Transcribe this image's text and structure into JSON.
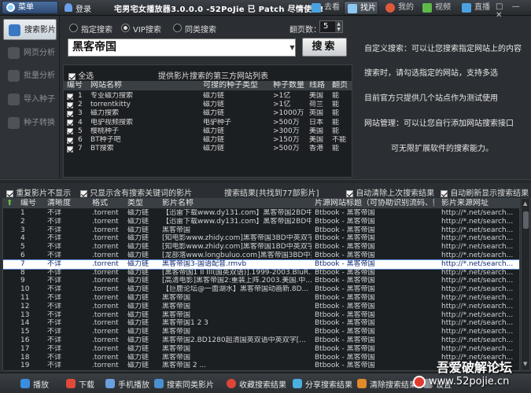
{
  "titlebar": {
    "menu_label": "菜单",
    "login_label": "登录",
    "title": "宅男宅女播放器3.0.0.0 -52PoJie 已 Patch 尽情使用!",
    "tabs": [
      "去看",
      "找片",
      "我的",
      "视频",
      "直播"
    ],
    "active_tab": "找片",
    "window_controls": "□ — ✕"
  },
  "sidebar": {
    "items": [
      {
        "label": "搜索影片",
        "active": true,
        "icon": "search-icon"
      },
      {
        "label": "网页分析",
        "active": false,
        "icon": "globe-icon"
      },
      {
        "label": "批量分析",
        "active": false,
        "icon": "batch-icon"
      },
      {
        "label": "导入种子",
        "active": false,
        "icon": "import-icon"
      },
      {
        "label": "种子转换",
        "active": false,
        "icon": "convert-icon"
      }
    ]
  },
  "search": {
    "modes": [
      "指定搜索",
      "VIP搜索",
      "同类搜索"
    ],
    "selected_mode": "VIP搜索",
    "pages_label": "翻页数：",
    "pages_value": "5",
    "keyword": "黑客帝国",
    "search_button": "搜索"
  },
  "site_list": {
    "select_all_label": "全选",
    "title": "提供影片搜索的第三方网站列表",
    "columns": [
      "编号",
      "网站名称",
      "可搜的种子类型",
      "种子数量",
      "线路",
      "翻页"
    ],
    "rows": [
      [
        "1",
        "专业磁力搜索",
        "磁力链",
        ">1亿",
        "美国",
        "能"
      ],
      [
        "2",
        "torrentkitty",
        "磁力链",
        ">1亿",
        "荷兰",
        "能"
      ],
      [
        "3",
        "磁力搜索",
        "磁力链",
        ">1000万",
        "英国",
        "能"
      ],
      [
        "4",
        "电驴视频搜索",
        "电驴种子",
        ">500万",
        "日本",
        "能"
      ],
      [
        "5",
        "樱桃种子",
        "磁力链",
        ">300万",
        "美国",
        "能"
      ],
      [
        "6",
        "BT种子吧",
        "磁力链",
        ">150万",
        "美国",
        "不能"
      ],
      [
        "7",
        "BT搜索",
        "磁力链",
        ">500万",
        "香港",
        "能"
      ]
    ]
  },
  "info": {
    "lines": [
      "自定义搜索：可以让您搜索指定网站上的内容",
      "搜索时，请勾选指定的网站，支持多选",
      "目前官方只提供几个站点作为测试使用",
      "网站管理：可以让您自行添加网站搜索接口",
      "可无限扩展软件的搜索能力。"
    ]
  },
  "options": {
    "no_duplicates": "重复影片不显示",
    "only_keyword": "只显示含有搜索关键词的影片",
    "result_summary": "搜索结果[共找到77部影片]",
    "auto_clear": "自动清除上次搜索结果",
    "auto_refresh": "自动刷新显示搜索结果"
  },
  "results": {
    "columns": [
      "编号",
      "清晰度",
      "格式",
      "类型",
      "影片名称",
      "片源网站标题（可协助识别流码、数.",
      "影片来源网址"
    ],
    "selected_row": 7,
    "rows": [
      [
        "1",
        "不详",
        ".torrent",
        "磁力链",
        "【迅雷下载www.dy131.com】黑客帝国2BD中...",
        "Btbook - 黑客帝国",
        "http://*.net/search..."
      ],
      [
        "2",
        "不详",
        ".torrent",
        "磁力链",
        "【迅雷下载www.dy131.com】黑客帝国2BD中...",
        "Btbook - 黑客帝国",
        "http://*.net/search..."
      ],
      [
        "3",
        "不详",
        ".torrent",
        "磁力链",
        "黑客帝国",
        "Btbook - 黑客帝国",
        "http://*.net/search..."
      ],
      [
        "4",
        "不详",
        ".torrent",
        "磁力链",
        "[知电影www.zhidy.com]黑客帝国3BD中英双字...",
        "Btbook - 黑客帝国",
        "http://*.net/search..."
      ],
      [
        "5",
        "不详",
        ".torrent",
        "磁力链",
        "[知电影www.zhidy.com]黑客帝国1BD中英双字...",
        "Btbook - 黑客帝国",
        "http://*.net/search..."
      ],
      [
        "6",
        "不详",
        ".torrent",
        "磁力链",
        "[龙部落www.longbuluo.com]黑客帝国3BD中英...",
        "Btbook - 黑客帝国",
        "http://*.net/search..."
      ],
      [
        "7",
        "不详",
        ".torrent",
        "磁力链",
        "黑客帝国3-国语配音.rmvb",
        "Btbook - 黑客帝国",
        "http://*.net/search..."
      ],
      [
        "8",
        "不详",
        ".torrent",
        "磁力链",
        "[黑客帝国1 II III(国英双语)].1999-2003.BluR...",
        "Btbook - 黑客帝国",
        "http://*.net/search..."
      ],
      [
        "9",
        "不详",
        ".torrent",
        "磁力链",
        "[高清电影]黑客帝国2:重装上阵.2003.美国.中...",
        "Btbook - 黑客帝国",
        "http://*.net/search..."
      ],
      [
        "10",
        "不详",
        ".torrent",
        "磁力链",
        "【巨鹿论坛@一面湖水】黑客帝国动画新.8D...",
        "Btbook - 黑客帝国",
        "http://*.net/search..."
      ],
      [
        "11",
        "不详",
        ".torrent",
        "磁力链",
        "黑客帝国",
        "Btbook - 黑客帝国",
        "http://*.net/search..."
      ],
      [
        "12",
        "不详",
        ".torrent",
        "磁力链",
        "黑客帝国",
        "Btbook - 黑客帝国",
        "http://*.net/search..."
      ],
      [
        "13",
        "不详",
        ".torrent",
        "磁力链",
        "黑客帝国",
        "Btbook - 黑客帝国",
        "http://*.net/search..."
      ],
      [
        "14",
        "不详",
        ".torrent",
        "磁力链",
        "黑客帝国1 2 3",
        "Btbook - 黑客帝国",
        "http://*.net/search..."
      ],
      [
        "15",
        "不详",
        ".torrent",
        "磁力链",
        "黑客帝国",
        "Btbook - 黑客帝国",
        "http://*.net/search..."
      ],
      [
        "16",
        "不详",
        ".torrent",
        "磁力链",
        "黑客帝国2.BD1280超清国英双语中英双字[...",
        "Btbook - 黑客帝国",
        "http://*.net/search..."
      ],
      [
        "17",
        "不详",
        ".torrent",
        "磁力链",
        "黑客帝国",
        "Btbook - 黑客帝国",
        "http://*.net/search..."
      ],
      [
        "18",
        "不详",
        ".torrent",
        "磁力链",
        "黑客帝国",
        "Btbook - 黑客帝国",
        "http://*.net/search..."
      ],
      [
        "19",
        "不详",
        ".torrent",
        "磁力链",
        "黑客帝国 2 ...",
        "Btbook - 黑客帝国",
        "http://*.net/search..."
      ]
    ]
  },
  "bottombar": {
    "buttons": [
      "播放",
      "下载",
      "手机播放",
      "搜索同类影片",
      "收藏搜索结果",
      "分享搜索结果",
      "清除搜索结果",
      "设置"
    ]
  },
  "watermark": {
    "main": "吾爱破解论坛",
    "url": "www.52pojie.cn"
  },
  "colors": {
    "background": "#2b2f33",
    "selected_row": "#ffffff",
    "accent": "#3a78c2"
  }
}
